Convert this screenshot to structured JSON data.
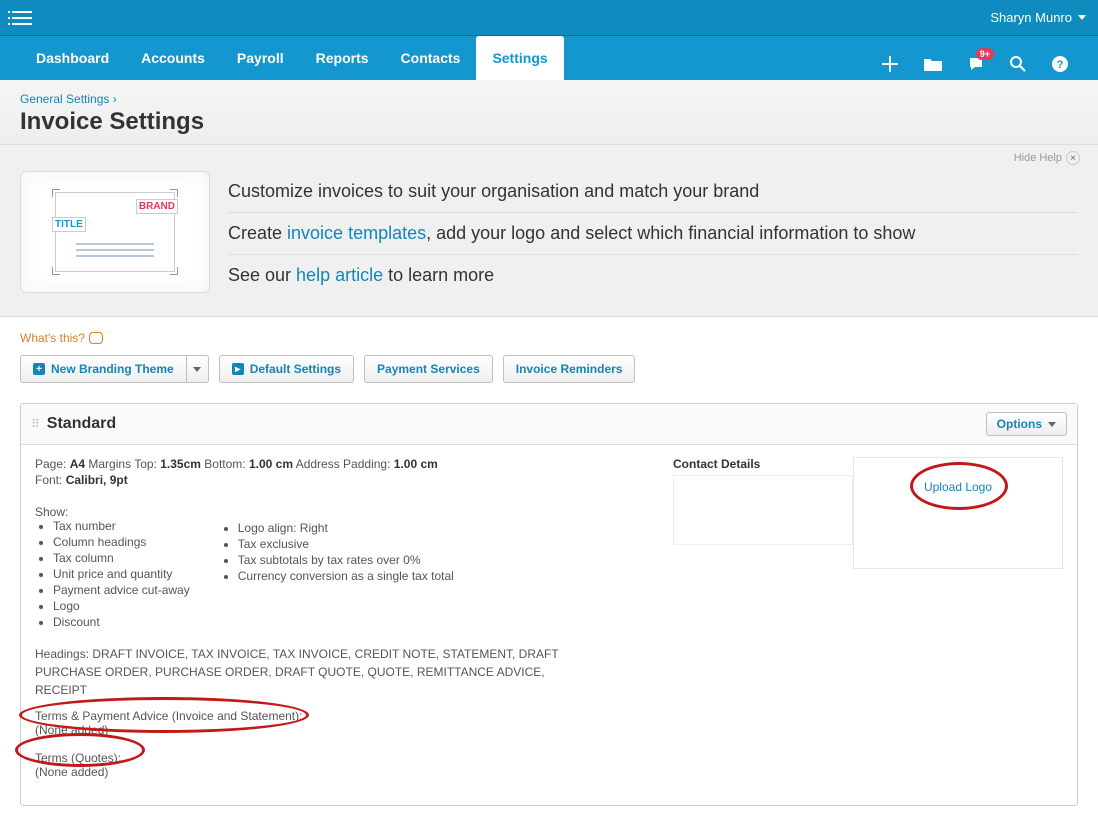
{
  "topbar": {
    "user_name": "Sharyn Munro"
  },
  "nav": {
    "items": [
      "Dashboard",
      "Accounts",
      "Payroll",
      "Reports",
      "Contacts",
      "Settings"
    ],
    "active_index": 5,
    "notification_badge": "9+"
  },
  "breadcrumb": {
    "parent": "General Settings",
    "sep": "›"
  },
  "page_title": "Invoice Settings",
  "intro": {
    "hide_help": "Hide Help",
    "line1": "Customize invoices to suit your organisation and match your brand",
    "line2_a": "Create ",
    "line2_link": "invoice templates",
    "line2_b": ", add your logo and select which financial information to show",
    "line3_a": "See our ",
    "line3_link": "help article",
    "line3_b": " to learn more",
    "preview_title": "TITLE",
    "preview_brand": "BRAND"
  },
  "toolbar": {
    "whats_this": "What's this?",
    "new_branding": "New Branding Theme",
    "default_settings": "Default Settings",
    "payment_services": "Payment Services",
    "invoice_reminders": "Invoice Reminders"
  },
  "panel": {
    "title": "Standard",
    "options": "Options",
    "page_label": "Page:",
    "page_size": "A4",
    "margins_top_label": "Margins Top:",
    "margins_top": "1.35cm",
    "bottom_label": "Bottom:",
    "bottom": "1.00 cm",
    "addr_pad_label": "Address Padding:",
    "addr_pad": "1.00 cm",
    "font_label": "Font:",
    "font": "Calibri, 9pt",
    "show_label": "Show:",
    "show_col1": [
      "Tax number",
      "Column headings",
      "Tax column",
      "Unit price and quantity",
      "Payment advice cut-away",
      "Logo",
      "Discount"
    ],
    "show_col2": [
      "Logo align: Right",
      "Tax exclusive",
      "Tax subtotals by tax rates over 0%",
      "Currency conversion as a single tax total"
    ],
    "headings_label": "Headings:",
    "headings": "DRAFT INVOICE, TAX INVOICE, TAX INVOICE, CREDIT NOTE, STATEMENT, DRAFT PURCHASE ORDER, PURCHASE ORDER, DRAFT QUOTE, QUOTE, REMITTANCE ADVICE, RECEIPT",
    "terms1_label": "Terms & Payment Advice (Invoice and Statement):",
    "terms1_val": "(None added)",
    "terms2_label": "Terms (Quotes):",
    "terms2_val": "(None added)",
    "contact_details": "Contact Details",
    "upload_logo": "Upload Logo"
  }
}
